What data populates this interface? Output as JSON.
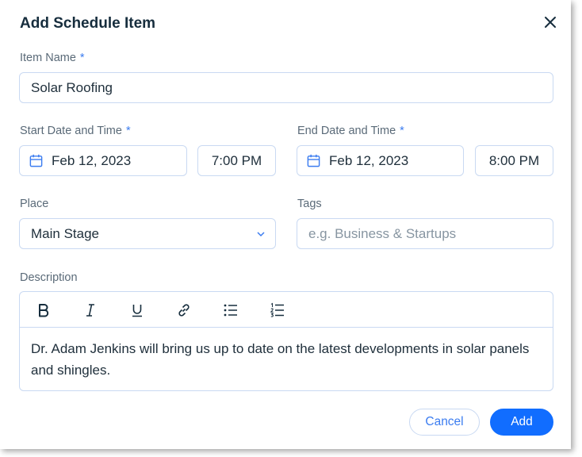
{
  "dialog": {
    "title": "Add Schedule Item",
    "close_icon": "close-icon"
  },
  "item_name": {
    "label": "Item Name",
    "required_mark": "*",
    "value": "Solar Roofing"
  },
  "start": {
    "label": "Start Date and Time",
    "required_mark": "*",
    "date": "Feb 12, 2023",
    "time": "7:00 PM",
    "icon": "calendar-icon"
  },
  "end": {
    "label": "End Date and Time",
    "required_mark": "*",
    "date": "Feb 12, 2023",
    "time": "8:00 PM",
    "icon": "calendar-icon"
  },
  "place": {
    "label": "Place",
    "value": "Main Stage",
    "icon": "chevron-down-icon"
  },
  "tags": {
    "label": "Tags",
    "placeholder": "e.g. Business & Startups"
  },
  "description": {
    "label": "Description",
    "toolbar": [
      "bold-icon",
      "italic-icon",
      "underline-icon",
      "link-icon",
      "bulleted-list-icon",
      "numbered-list-icon"
    ],
    "text": "Dr. Adam Jenkins will bring us up to date on the latest developments in solar panels and shingles."
  },
  "actions": {
    "cancel_label": "Cancel",
    "add_label": "Add"
  },
  "colors": {
    "accent": "#116dff",
    "border": "#c9d9f2",
    "required": "#3b7cf0"
  }
}
